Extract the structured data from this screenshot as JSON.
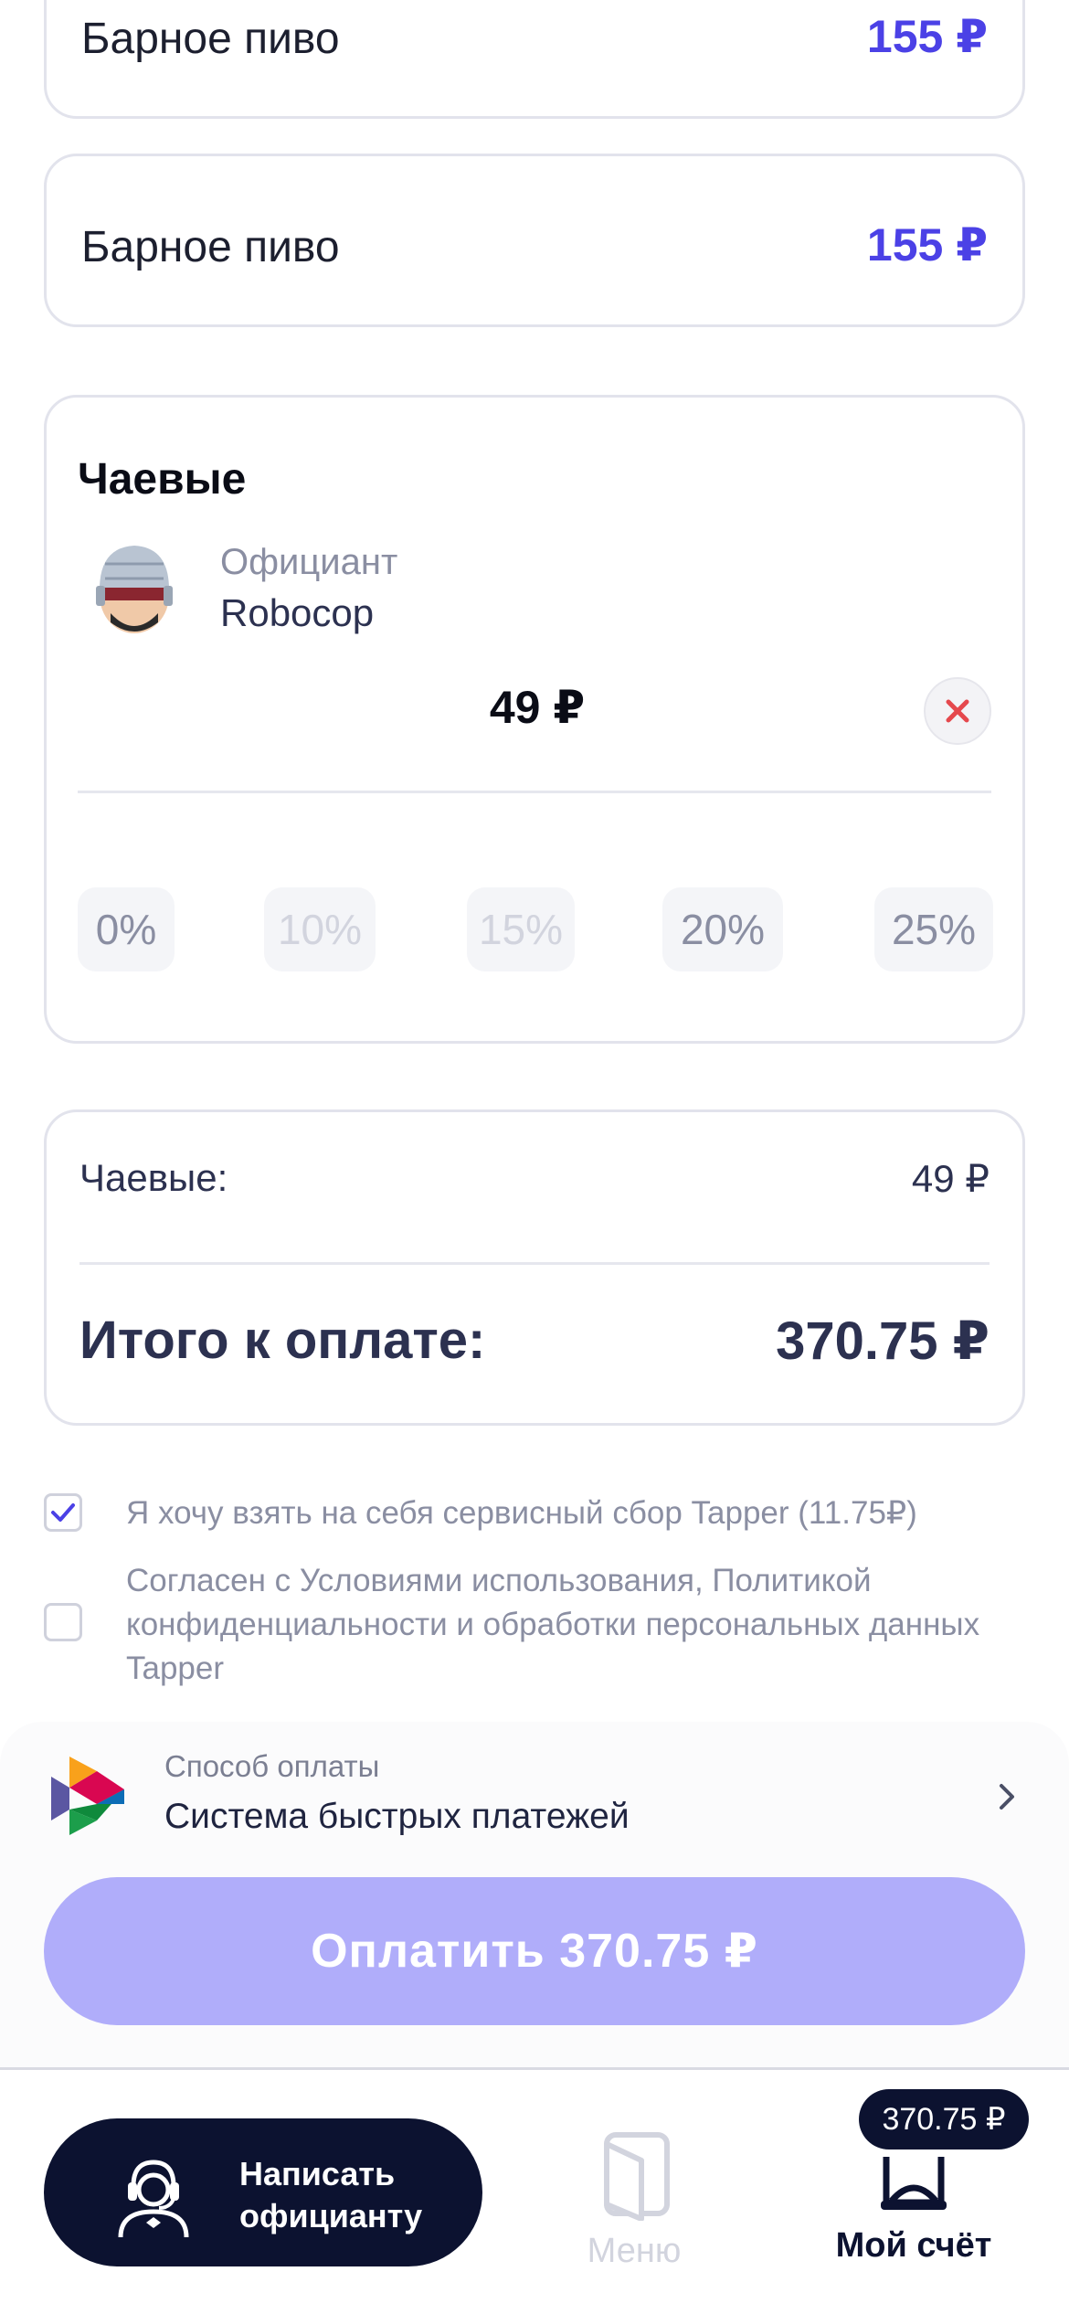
{
  "order_items": [
    {
      "name": "Барное пиво",
      "price": "155 ₽"
    },
    {
      "name": "Барное пиво",
      "price": "155 ₽"
    }
  ],
  "tips": {
    "title": "Чаевые",
    "waiter_role": "Официант",
    "waiter_name": "Robocop",
    "amount": "49 ₽",
    "percent_options": [
      "0%",
      "10%",
      "15%",
      "20%",
      "25%"
    ]
  },
  "summary": {
    "tips_label": "Чаевые:",
    "tips_value": "49 ₽",
    "total_label": "Итого к оплате:",
    "total_value": "370.75 ₽"
  },
  "consents": {
    "service_fee": {
      "text": "Я хочу взять на себя сервисный сбор Tapper (11.75₽)",
      "checked": true
    },
    "terms": {
      "line1": "Согласен с Условиями использования, Политикой",
      "line2": "конфиденциальности и обработки персональных данных",
      "line3": "Tapper",
      "checked": false
    }
  },
  "payment": {
    "method_label": "Способ оплаты",
    "method_value": "Система быстрых платежей",
    "pay_button": "Оплатить 370.75 ₽"
  },
  "bottom_nav": {
    "chat_line1": "Написать",
    "chat_line2": "официанту",
    "menu_label": "Меню",
    "bill_label": "Мой счёт",
    "bill_badge": "370.75 ₽"
  },
  "colors": {
    "accent": "#4b41e6",
    "pay_button": "#b0adfa",
    "dark": "#0c1230",
    "close_x": "#e5484d"
  },
  "icons": [
    "waiter-avatar",
    "close-icon",
    "checkmark-icon",
    "sbp-logo",
    "chevron-right-icon",
    "waiter-headset-icon",
    "menu-book-icon",
    "bill-icon"
  ]
}
